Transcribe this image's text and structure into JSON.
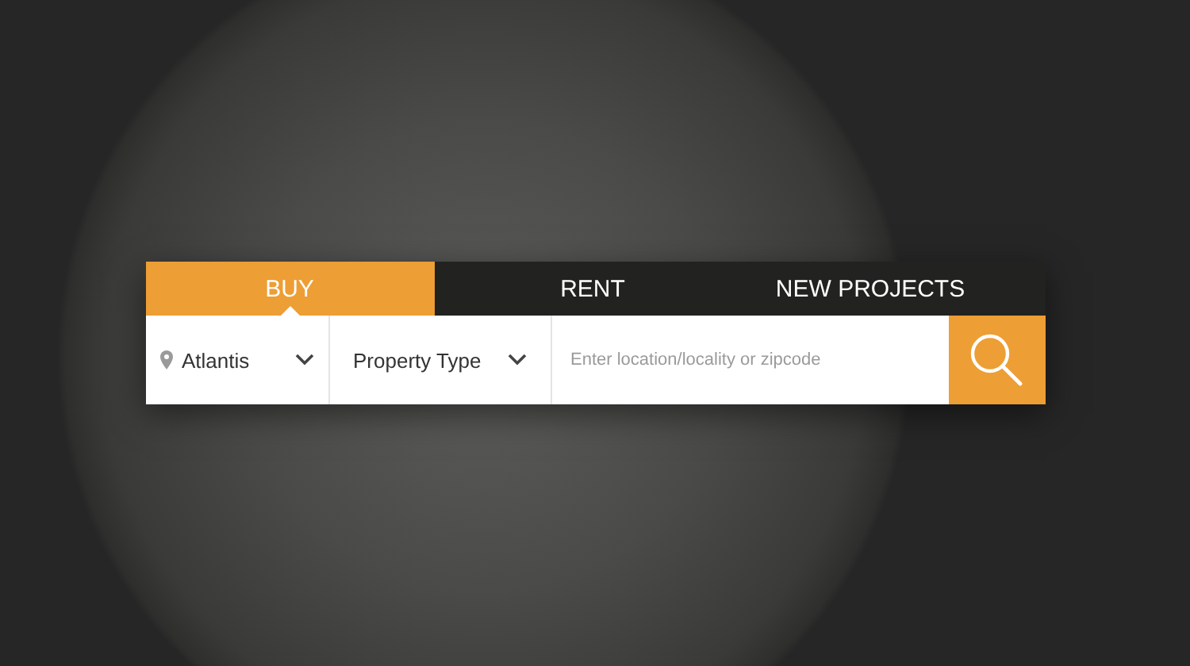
{
  "tabs": [
    {
      "label": "BUY",
      "selected": true
    },
    {
      "label": "RENT",
      "selected": false
    },
    {
      "label": "NEW PROJECTS",
      "selected": false
    }
  ],
  "location": {
    "value": "Atlantis"
  },
  "property_type": {
    "value": "Property Type"
  },
  "search": {
    "placeholder": "Enter location/locality or zipcode"
  }
}
